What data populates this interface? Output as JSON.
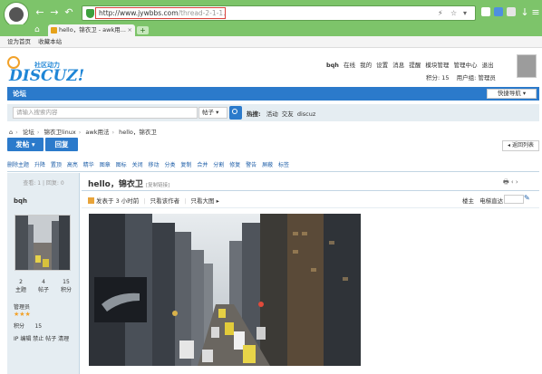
{
  "browser": {
    "url_main": "http://www.jywbbs.com",
    "url_path": "/thread-2-1-1.html",
    "tab_title": "hello，锦衣卫 - awk用...",
    "new_tab": "+",
    "bookmarks": [
      "设为首页",
      "收藏本站"
    ]
  },
  "site": {
    "logo_small": "社区动力",
    "logo_text": "DISCUZ!",
    "user": {
      "name": "bqh",
      "status": "在线",
      "links": [
        "我的",
        "设置",
        "消息",
        "提醒",
        "模块管理",
        "管理中心",
        "退出"
      ],
      "points_label": "积分: 15",
      "group_label": "用户组: 管理员"
    },
    "nav": {
      "forum": "论坛",
      "quick_nav": "快捷导航"
    },
    "search": {
      "placeholder": "请输入搜索内容",
      "type": "帖子",
      "hot_label": "热搜:",
      "hot_terms": [
        "活动",
        "交友",
        "discuz"
      ]
    },
    "breadcrumb": [
      "论坛",
      "锦衣卫linux",
      "awk用法",
      "hello，锦衣卫"
    ],
    "buttons": {
      "post": "发帖",
      "reply": "回复",
      "back": "返回列表"
    },
    "tags": [
      "删除主题",
      "升降",
      "置顶",
      "高亮",
      "精华",
      "图章",
      "图标",
      "关闭",
      "移动",
      "分类",
      "复制",
      "合并",
      "分割",
      "修复",
      "警告",
      "屏蔽",
      "标签"
    ]
  },
  "thread": {
    "title": "hello，锦衣卫",
    "copy_link": "[复制链接]",
    "views_label": "查看: 1",
    "replies_label": "回复: 0",
    "posted": "发表于 3 小时前",
    "only_author": "只看该作者",
    "only_big_image": "只看大图",
    "floor_label": "楼主",
    "jump_label": "电梯直达"
  },
  "author": {
    "name": "bqh",
    "stats": [
      {
        "value": "2",
        "label": "主题"
      },
      {
        "value": "4",
        "label": "帖子"
      },
      {
        "value": "15",
        "label": "积分"
      }
    ],
    "group": "管理员",
    "points_label": "积分",
    "points_value": "15",
    "admin_links": [
      "IP",
      "编辑",
      "禁止",
      "帖子",
      "清理"
    ]
  },
  "icons": {
    "back": "arrow-left-icon",
    "forward": "arrow-right-icon",
    "refresh": "refresh-icon",
    "undo": "undo-icon",
    "star": "star-icon",
    "home": "home-icon",
    "menu": "menu-icon"
  }
}
